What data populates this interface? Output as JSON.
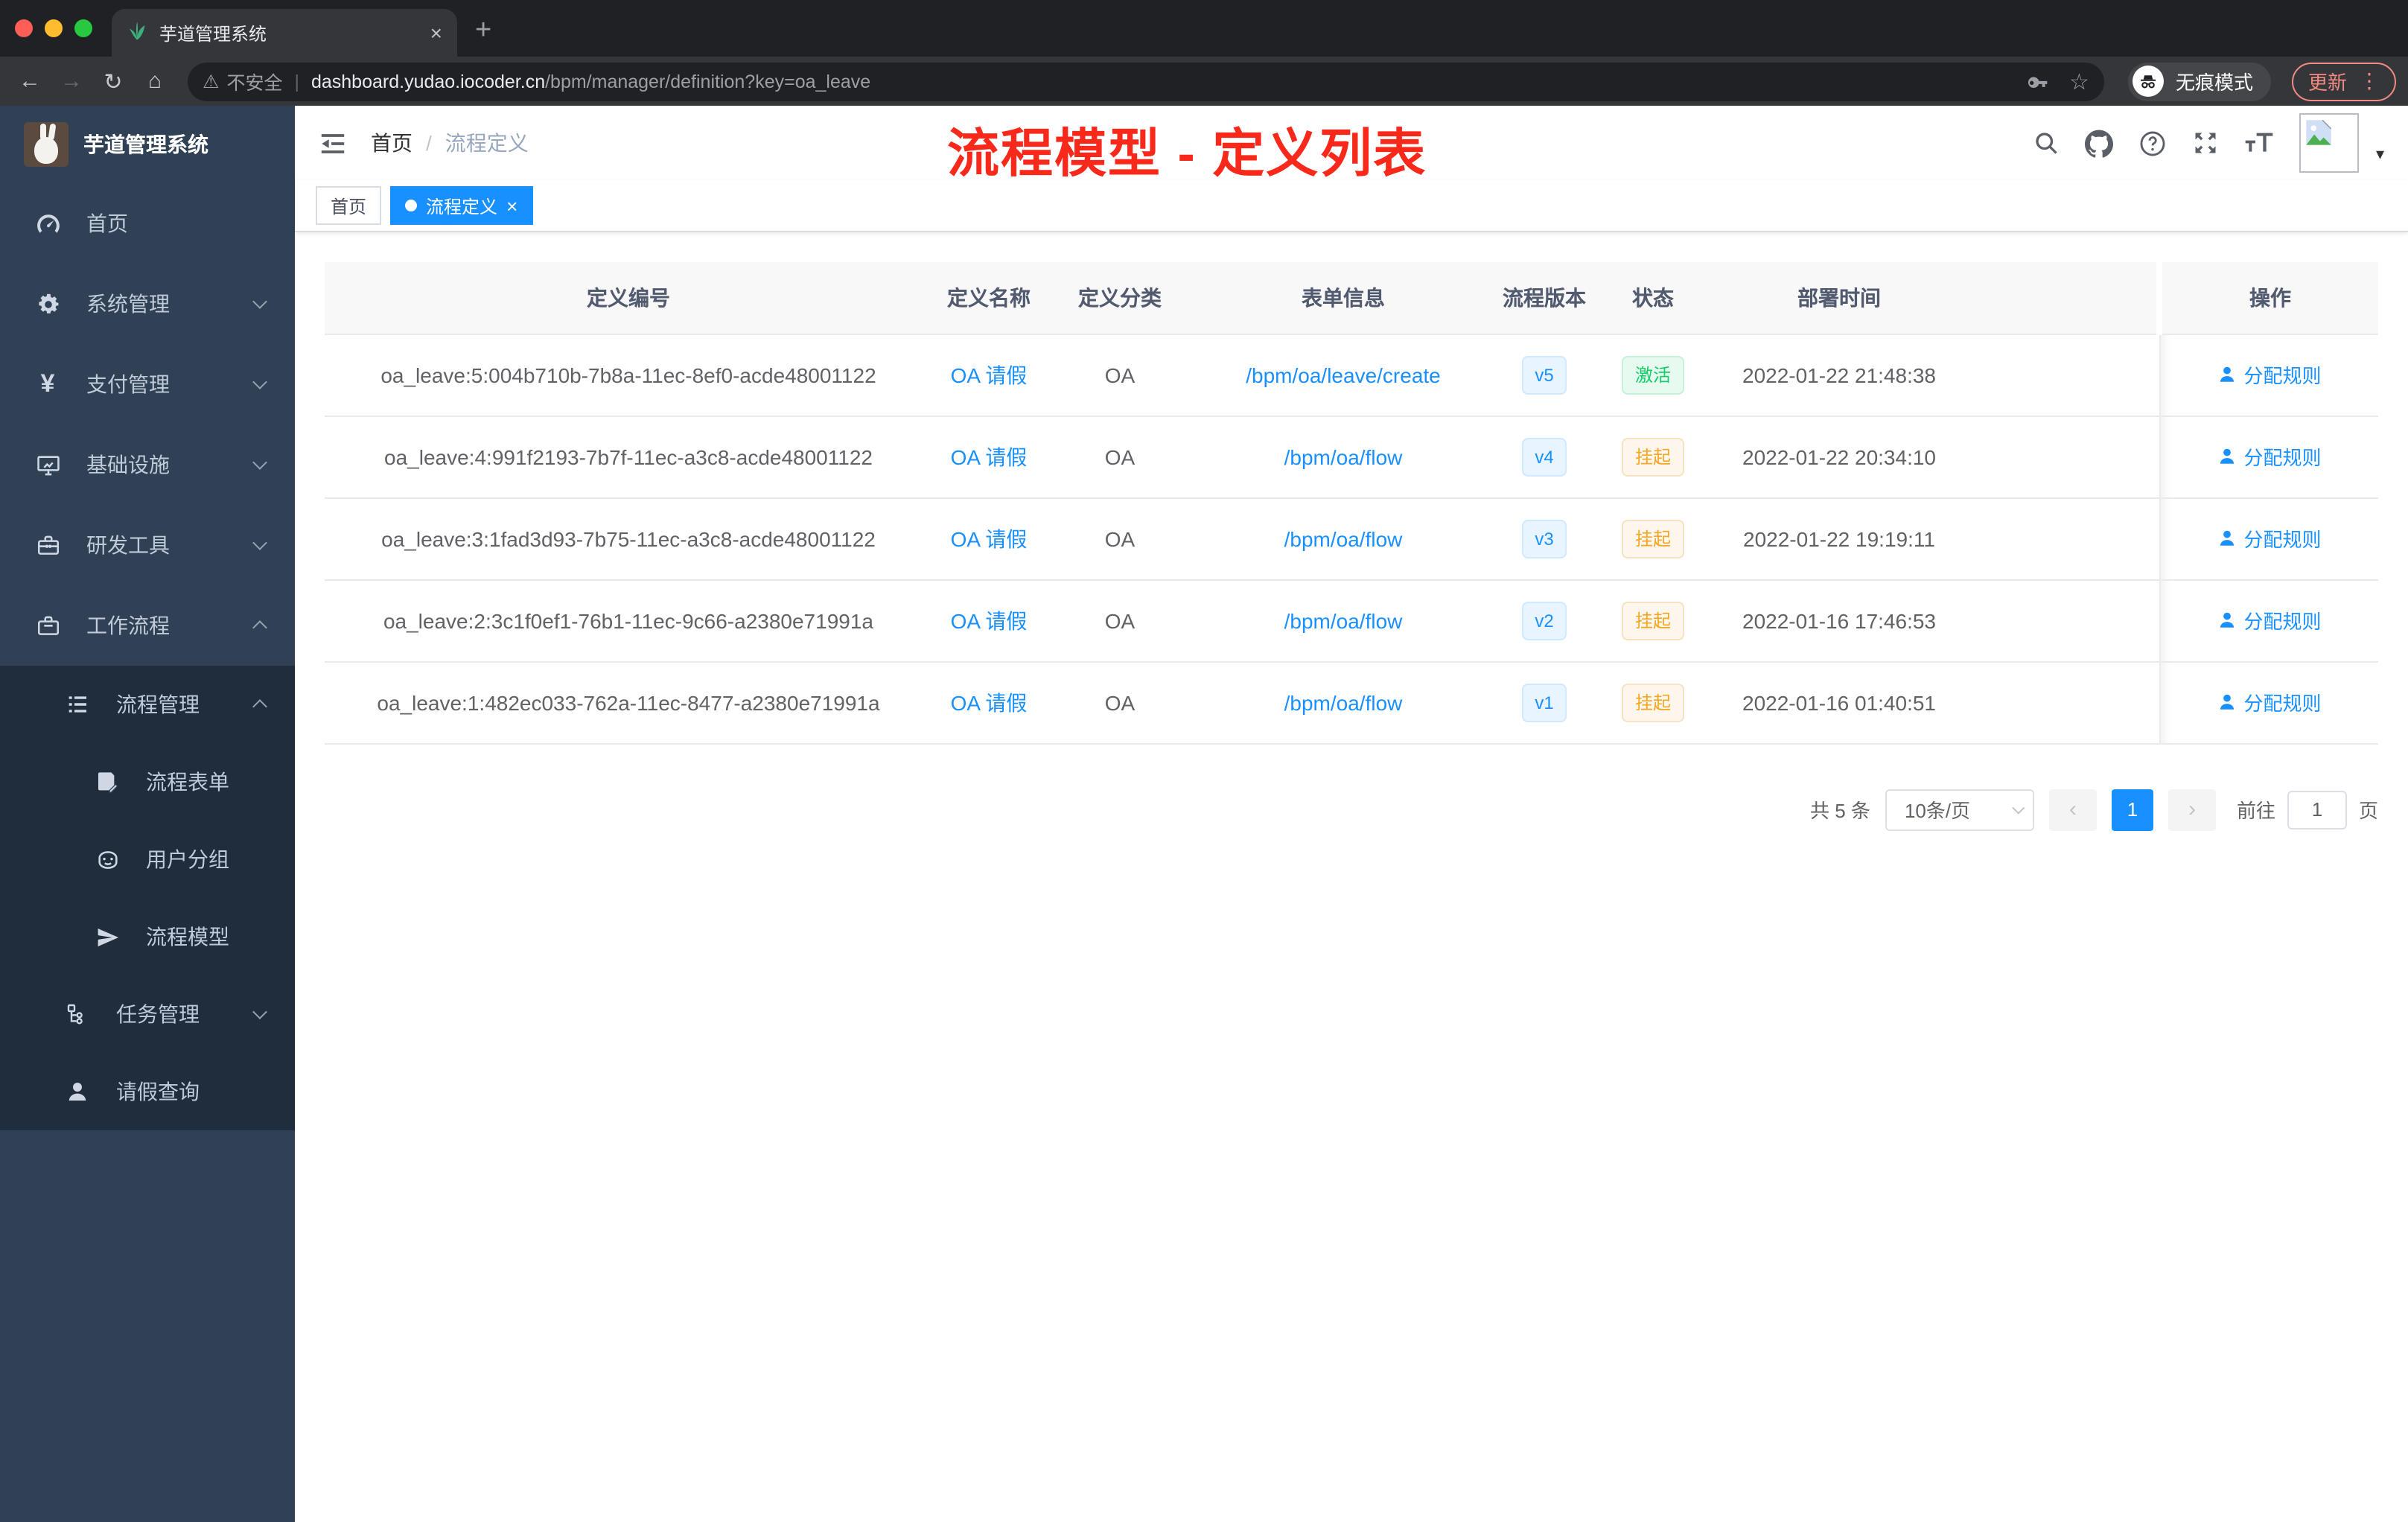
{
  "browser": {
    "tab": {
      "title": "芋道管理系统"
    },
    "address": {
      "security_label": "不安全",
      "domain": "dashboard.yudao.iocoder.cn",
      "path": "/bpm/manager/definition?key=oa_leave"
    },
    "incognito_label": "无痕模式",
    "update_label": "更新"
  },
  "icons": {
    "back": "←",
    "forward": "→",
    "reload": "↻",
    "home": "⌂",
    "warning": "⚠",
    "star": "☆",
    "menu_dots": "⋮",
    "caret_down": "▾",
    "close": "×",
    "new_tab": "+",
    "prev": "‹",
    "next": "›",
    "breadcrumb_separator": "/",
    "yen": "¥"
  },
  "sidebar": {
    "title": "芋道管理系统",
    "items": [
      {
        "label": "首页",
        "icon": "dashboard-icon"
      },
      {
        "label": "系统管理",
        "icon": "gear-icon"
      },
      {
        "label": "支付管理",
        "icon": "yen-icon"
      },
      {
        "label": "基础设施",
        "icon": "monitor-icon"
      },
      {
        "label": "研发工具",
        "icon": "toolbox-icon"
      },
      {
        "label": "工作流程",
        "icon": "briefcase-icon"
      }
    ],
    "submenu": [
      {
        "label": "流程管理",
        "icon": "list-icon"
      },
      {
        "label": "流程表单",
        "icon": "form-icon"
      },
      {
        "label": "用户分组",
        "icon": "robot-icon"
      },
      {
        "label": "流程模型",
        "icon": "send-icon"
      },
      {
        "label": "任务管理",
        "icon": "tree-icon"
      },
      {
        "label": "请假查询",
        "icon": "user-icon"
      }
    ]
  },
  "header": {
    "breadcrumb": {
      "root": "首页",
      "current": "流程定义"
    },
    "annotation": "流程模型 - 定义列表"
  },
  "tags": {
    "home": "首页",
    "active": "流程定义"
  },
  "table": {
    "columns": [
      "定义编号",
      "定义名称",
      "定义分类",
      "表单信息",
      "流程版本",
      "状态",
      "部署时间",
      "操作"
    ],
    "rows": [
      {
        "id": "oa_leave:5:004b710b-7b8a-11ec-8ef0-acde48001122",
        "name": "OA 请假",
        "category": "OA",
        "form": "/bpm/oa/leave/create",
        "version": "v5",
        "status": "激活",
        "status_type": "success",
        "deploy_time": "2022-01-22 21:48:38",
        "action": "分配规则"
      },
      {
        "id": "oa_leave:4:991f2193-7b7f-11ec-a3c8-acde48001122",
        "name": "OA 请假",
        "category": "OA",
        "form": "/bpm/oa/flow",
        "version": "v4",
        "status": "挂起",
        "status_type": "warning",
        "deploy_time": "2022-01-22 20:34:10",
        "action": "分配规则"
      },
      {
        "id": "oa_leave:3:1fad3d93-7b75-11ec-a3c8-acde48001122",
        "name": "OA 请假",
        "category": "OA",
        "form": "/bpm/oa/flow",
        "version": "v3",
        "status": "挂起",
        "status_type": "warning",
        "deploy_time": "2022-01-22 19:19:11",
        "action": "分配规则"
      },
      {
        "id": "oa_leave:2:3c1f0ef1-76b1-11ec-9c66-a2380e71991a",
        "name": "OA 请假",
        "category": "OA",
        "form": "/bpm/oa/flow",
        "version": "v2",
        "status": "挂起",
        "status_type": "warning",
        "deploy_time": "2022-01-16 17:46:53",
        "action": "分配规则"
      },
      {
        "id": "oa_leave:1:482ec033-762a-11ec-8477-a2380e71991a",
        "name": "OA 请假",
        "category": "OA",
        "form": "/bpm/oa/flow",
        "version": "v1",
        "status": "挂起",
        "status_type": "warning",
        "deploy_time": "2022-01-16 01:40:51",
        "action": "分配规则"
      }
    ]
  },
  "pagination": {
    "total": "共 5 条",
    "page_size": "10条/页",
    "current": "1",
    "goto": "前往",
    "unit": "页",
    "goto_value": "1"
  },
  "colors": {
    "accent_blue": "#1890ff",
    "success_green": "#13ce66",
    "warning_orange": "#f5a623",
    "sidebar_bg": "#304156",
    "submenu_bg": "#1f2d3d",
    "annotation_red": "#f8291b"
  }
}
